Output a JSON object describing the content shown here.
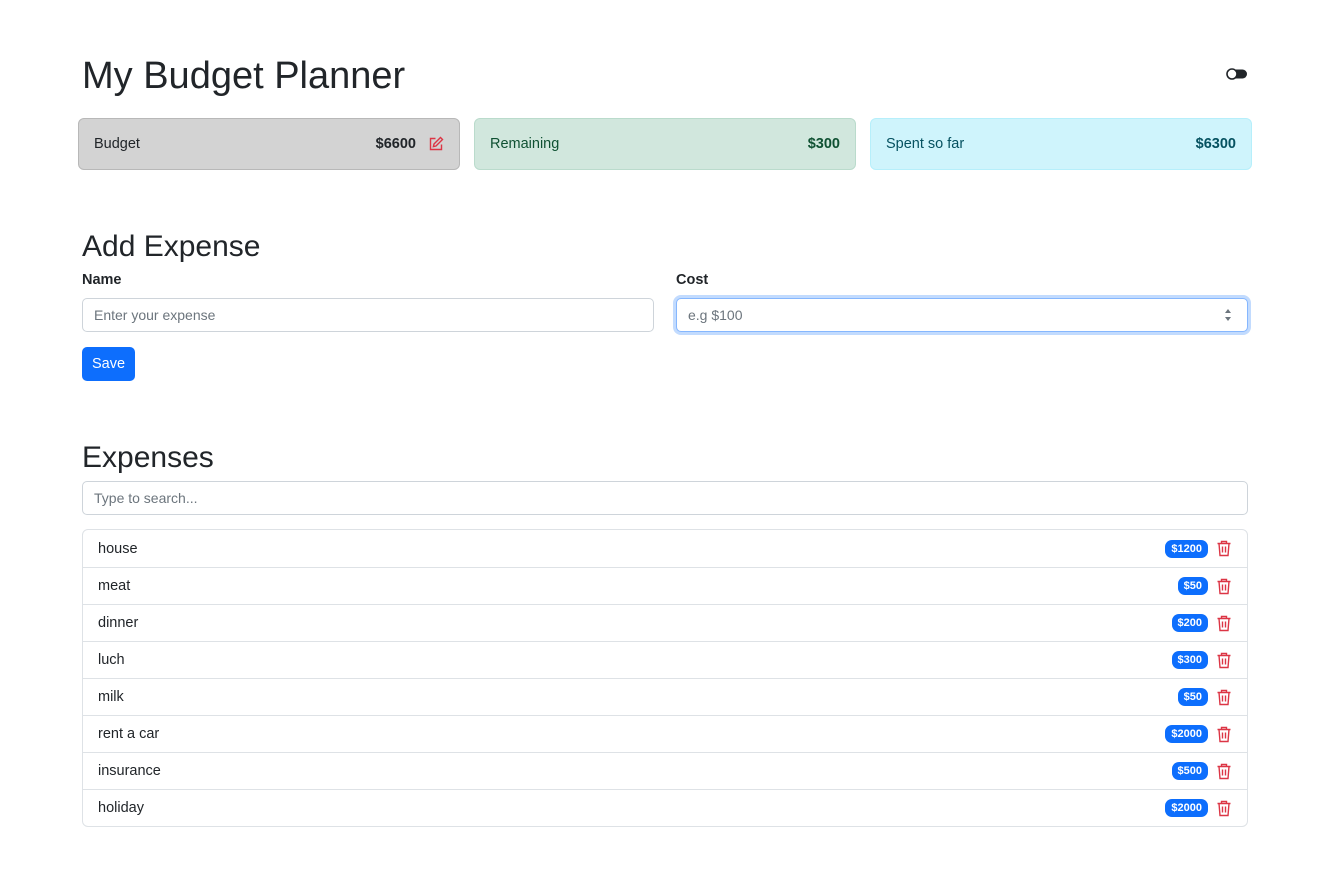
{
  "app": {
    "title": "My Budget Planner"
  },
  "stats": {
    "budget": {
      "label": "Budget",
      "value": "$6600"
    },
    "remaining": {
      "label": "Remaining",
      "value": "$300"
    },
    "spent": {
      "label": "Spent so far",
      "value": "$6300"
    }
  },
  "add_expense": {
    "heading": "Add Expense",
    "name_label": "Name",
    "name_placeholder": "Enter your expense",
    "cost_label": "Cost",
    "cost_placeholder": "e.g $100",
    "save_label": "Save"
  },
  "expenses": {
    "heading": "Expenses",
    "search_placeholder": "Type to search...",
    "items": [
      {
        "name": "house",
        "cost": "$1200"
      },
      {
        "name": "meat",
        "cost": "$50"
      },
      {
        "name": "dinner",
        "cost": "$200"
      },
      {
        "name": "luch",
        "cost": "$300"
      },
      {
        "name": "milk",
        "cost": "$50"
      },
      {
        "name": "rent a car",
        "cost": "$2000"
      },
      {
        "name": "insurance",
        "cost": "$500"
      },
      {
        "name": "holiday",
        "cost": "$2000"
      }
    ]
  },
  "icons": {
    "toggle": "toggle-icon",
    "edit": "edit-icon",
    "delete": "trash-icon"
  },
  "colors": {
    "primary": "#0d6efd",
    "danger": "#dc3545",
    "budget_bg": "#d3d3d3",
    "remaining_bg": "#d1e7dd",
    "spent_bg": "#cff4fc"
  }
}
